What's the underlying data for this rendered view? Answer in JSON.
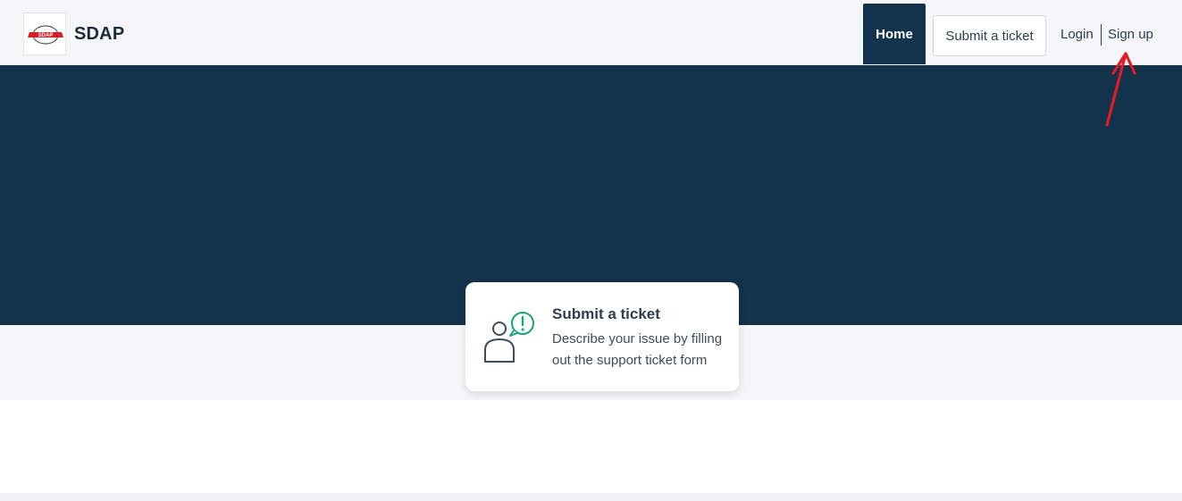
{
  "header": {
    "brand": "SDAP",
    "logo_text": "SDAP",
    "nav": {
      "home": "Home",
      "submit_ticket": "Submit a ticket",
      "login": "Login",
      "signup": "Sign up"
    }
  },
  "card": {
    "title": "Submit a ticket",
    "description": "Describe your issue by filling out the support ticket form",
    "icon": "person-alert-icon"
  },
  "colors": {
    "primary": "#13334c",
    "accent": "#1aa37a",
    "annotation": "#e01b24",
    "background": "#f5f6f8"
  }
}
